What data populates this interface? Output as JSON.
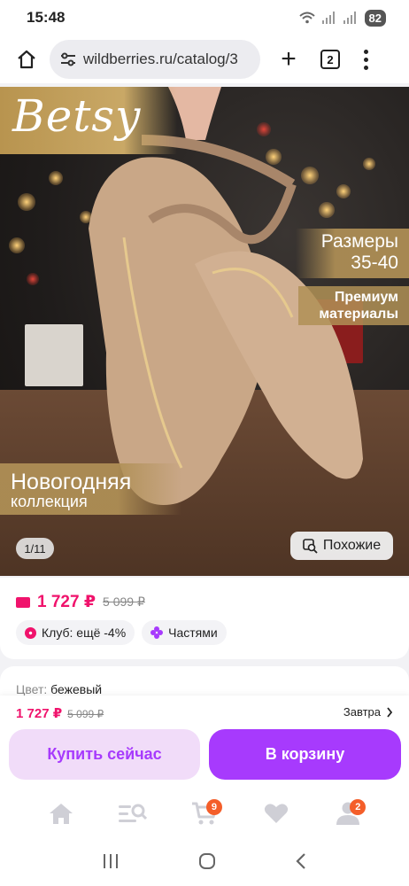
{
  "status_bar": {
    "time": "15:48",
    "battery": "82"
  },
  "browser": {
    "url": "wildberries.ru/catalog/3",
    "tab_count": "2"
  },
  "product_image": {
    "brand": "Betsy",
    "sizes_title": "Размеры",
    "sizes_range": "35-40",
    "materials_line1": "Премиум",
    "materials_line2": "материалы",
    "collection_title": "Новогодняя",
    "collection_sub": "коллекция",
    "counter": "1/11",
    "similar_label": "Похожие"
  },
  "price": {
    "current": "1 727 ₽",
    "old": "5 099 ₽",
    "club_label": "Клуб: ещё -4%",
    "parts_label": "Частями"
  },
  "color": {
    "label": "Цвет:",
    "value": "бежевый"
  },
  "purchase_bar": {
    "price": "1 727 ₽",
    "old": "5 099 ₽",
    "delivery": "Завтра",
    "buy_now": "Купить сейчас",
    "add_to_cart": "В корзину"
  },
  "bottom_nav": {
    "cart_badge": "9",
    "profile_badge": "2"
  },
  "colors": {
    "accent": "#a73afd",
    "price": "#f0136c",
    "badge": "#f45e2a"
  }
}
